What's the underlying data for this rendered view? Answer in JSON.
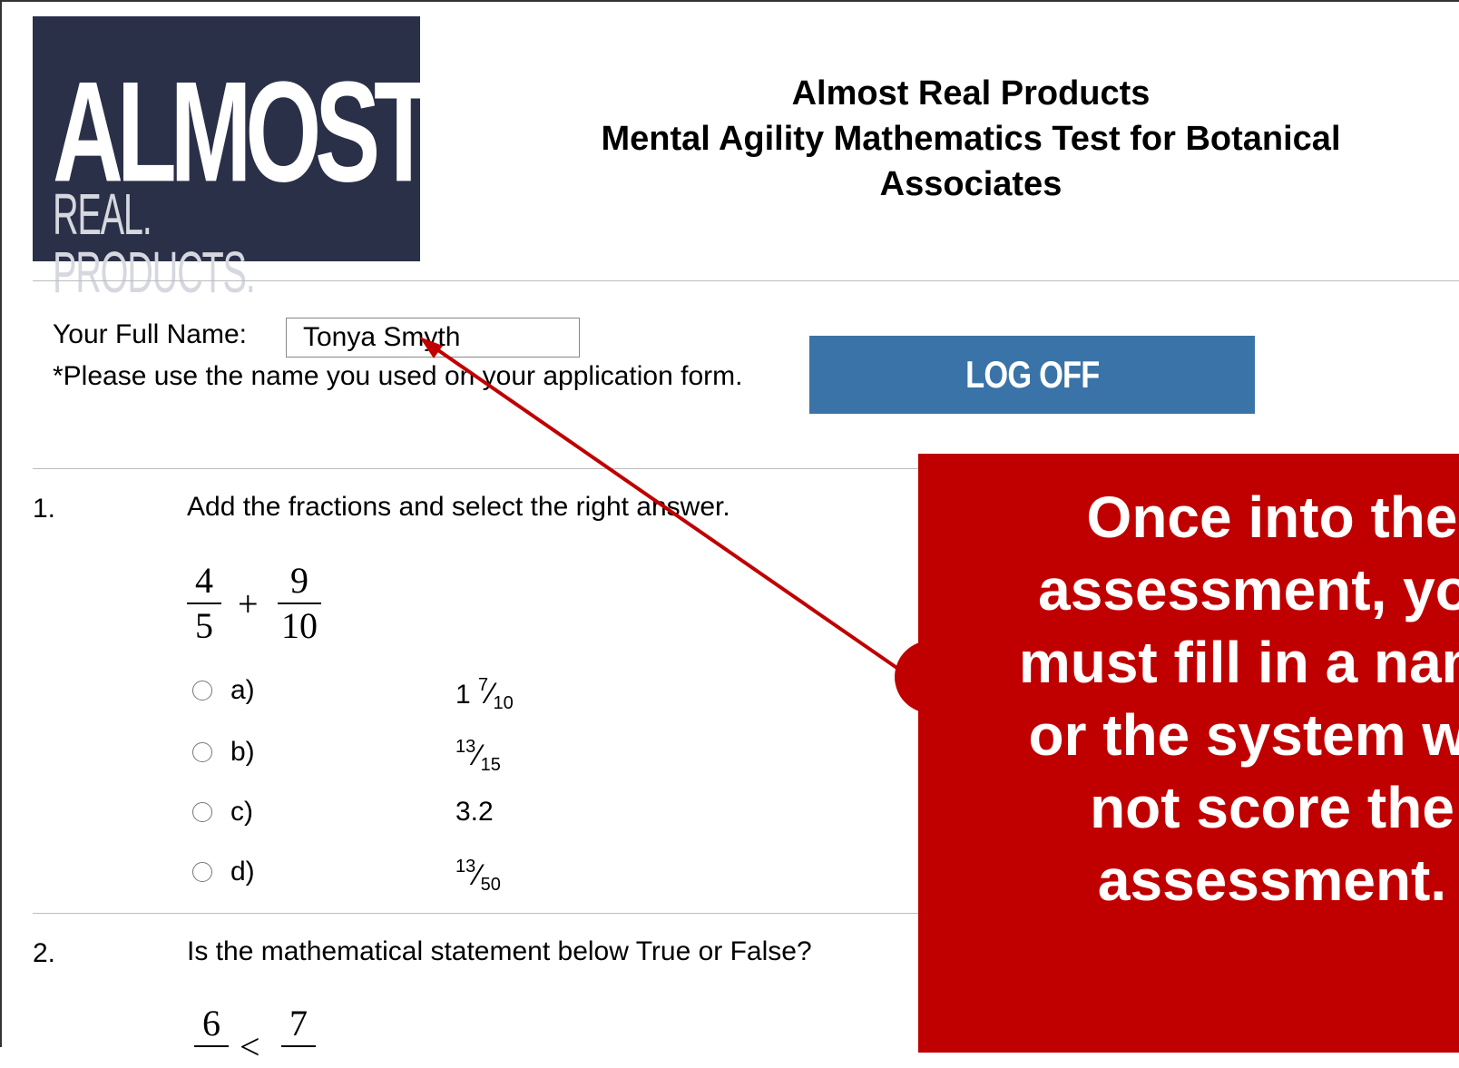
{
  "logo": {
    "line1": "ALMOST",
    "line2": "REAL. PRODUCTS."
  },
  "header": {
    "line1": "Almost Real Products",
    "line2": "Mental Agility Mathematics Test for Botanical",
    "line3": "Associates"
  },
  "name_section": {
    "label": "Your Full Name:",
    "value": "Tonya Smyth",
    "note": "*Please use the name you used on your application form."
  },
  "logoff": {
    "label": "LOG OFF"
  },
  "q1": {
    "number": "1.",
    "text": "Add the fractions and select the right answer.",
    "expr": {
      "n1": "4",
      "d1": "5",
      "op": "+",
      "n2": "9",
      "d2": "10"
    },
    "options": [
      {
        "label": "a)",
        "whole": "1",
        "num": "7",
        "den": "10"
      },
      {
        "label": "b)",
        "whole": "",
        "num": "13",
        "den": "15"
      },
      {
        "label": "c)",
        "plain": "3.2"
      },
      {
        "label": "d)",
        "whole": "",
        "num": "13",
        "den": "50"
      }
    ]
  },
  "q2": {
    "number": "2.",
    "text": "Is the mathematical statement below True or False?",
    "expr": {
      "n1": "6",
      "op": "<",
      "n2": "7"
    }
  },
  "callout": {
    "text": "Once into the\nassessment, you\nmust fill in a name\nor the system will\nnot score the\nassessment."
  },
  "colors": {
    "callout": "#c00000",
    "logoff": "#3a73a7",
    "logo_bg": "#2b3049"
  }
}
